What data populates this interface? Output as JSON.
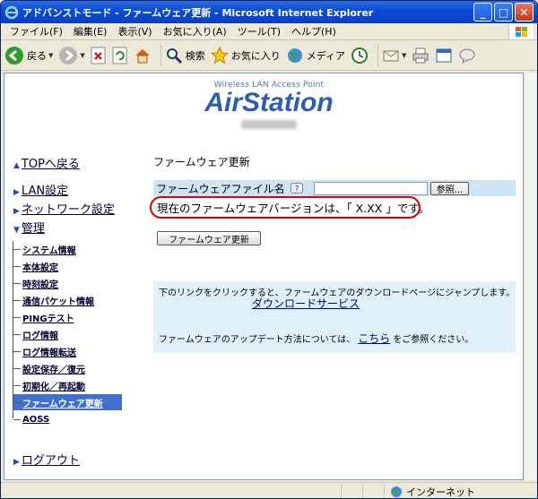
{
  "window": {
    "title": "アドバンストモード - ファームウェア更新 - Microsoft Internet Explorer",
    "minimize": "_",
    "maximize": "□",
    "close": "✕"
  },
  "menubar": {
    "items": [
      "ファイル(F)",
      "編集(E)",
      "表示(V)",
      "お気に入り(A)",
      "ツール(T)",
      "ヘルプ(H)"
    ]
  },
  "toolbar": {
    "back": "戻る",
    "search": "検索",
    "favorites": "お気に入り",
    "media": "メディア"
  },
  "header": {
    "tagline": "Wireless LAN Access Point",
    "brand": "AirStation"
  },
  "nav": {
    "top": "TOPへ戻る",
    "lan": "LAN設定",
    "network": "ネットワーク設定",
    "admin": "管理",
    "logout": "ログアウト",
    "sub": [
      "システム情報",
      "本体設定",
      "時刻設定",
      "通信パケット情報",
      "PINGテスト",
      "ログ情報",
      "ログ情報転送",
      "設定保存／復元",
      "初期化／再起動",
      "ファームウェア更新",
      "AOSS"
    ]
  },
  "main": {
    "heading": "ファームウェア更新",
    "file_label": "ファームウェアファイル名",
    "file_value": "",
    "browse": "参照...",
    "version_text": "現在のファームウェアバージョンは、「 X.XX 」です。",
    "update_button": "ファームウェア更新",
    "info_line1": "下のリンクをクリックすると、ファームウェアのダウンロードページにジャンプします。",
    "download_link": "ダウンロードサービス",
    "info_line2_pre": "ファームウェアのアップデート方法については、",
    "here_link": "こちら",
    "info_line2_post": "をご参照ください。"
  },
  "status": {
    "zone": "インターネット"
  }
}
